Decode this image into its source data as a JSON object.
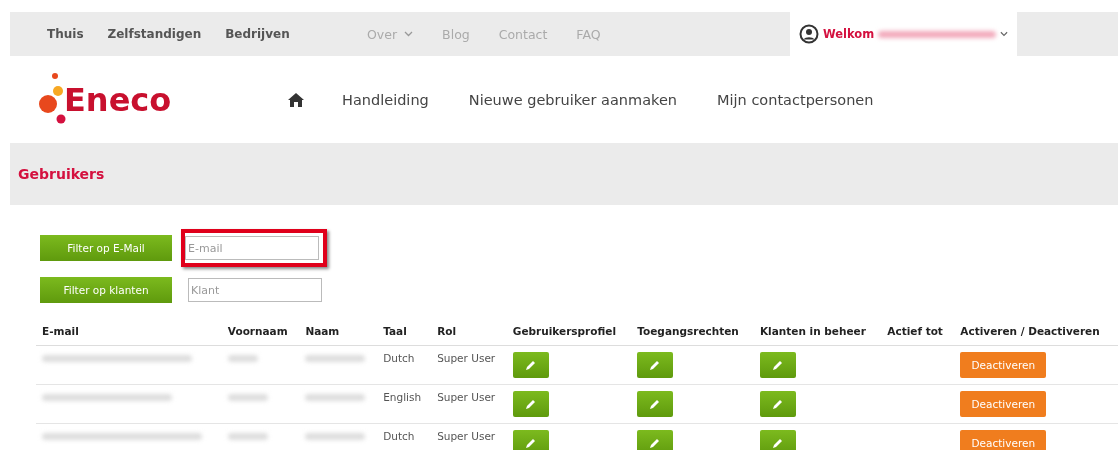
{
  "top_nav": {
    "left": [
      {
        "label": "Thuis"
      },
      {
        "label": "Zelfstandigen"
      },
      {
        "label": "Bedrijven"
      }
    ],
    "middle": [
      {
        "label": "Over",
        "dropdown": true
      },
      {
        "label": "Blog",
        "dropdown": false
      },
      {
        "label": "Contact",
        "dropdown": false
      },
      {
        "label": "FAQ",
        "dropdown": false
      }
    ],
    "account": {
      "greeting": "Welkom"
    }
  },
  "header": {
    "logo": "Eneco",
    "menu": [
      "Handleiding",
      "Nieuwe gebruiker aanmaken",
      "Mijn contactpersonen"
    ]
  },
  "page_title": "Gebruikers",
  "filters": [
    {
      "button": "Filter op E-Mail",
      "placeholder": "E-mail",
      "highlighted": true
    },
    {
      "button": "Filter op klanten",
      "placeholder": "Klant",
      "highlighted": false
    }
  ],
  "table": {
    "columns": [
      "E-mail",
      "Voornaam",
      "Naam",
      "Taal",
      "Rol",
      "Gebruikersprofiel",
      "Toegangsrechten",
      "Klanten in beheer",
      "Actief tot",
      "Activeren / Deactiveren"
    ],
    "rows": [
      {
        "taal": "Dutch",
        "rol": "Super User",
        "action": "Deactiveren"
      },
      {
        "taal": "English",
        "rol": "Super User",
        "action": "Deactiveren"
      },
      {
        "taal": "Dutch",
        "rol": "Super User",
        "action": "Deactiveren"
      }
    ]
  }
}
